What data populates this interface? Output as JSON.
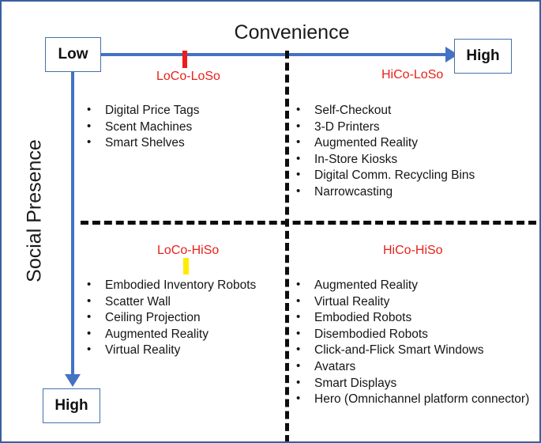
{
  "axes": {
    "x_title": "Convenience",
    "y_title": "Social Presence",
    "x_low_label": "Low",
    "x_high_label": "High",
    "y_low_label": "Low",
    "y_high_label": "High"
  },
  "colors": {
    "axis_blue": "#4472C4",
    "frame_blue": "#3a5f9e",
    "quad_label_red": "#e8211b",
    "marker_red": "#ee1c1c",
    "marker_yellow": "#ffeb00",
    "divider_black": "#0d0d0d"
  },
  "quadrants": [
    {
      "id": "loco-loso",
      "label": "LoCo-LoSo",
      "marker": "red",
      "items": [
        "Digital Price Tags",
        "Scent Machines",
        "Smart Shelves"
      ]
    },
    {
      "id": "hico-loso",
      "label": "HiCo-LoSo",
      "marker": "none",
      "items": [
        "Self-Checkout",
        "3-D Printers",
        "Augmented Reality",
        "In-Store Kiosks",
        "Digital Comm. Recycling Bins",
        "Narrowcasting"
      ]
    },
    {
      "id": "loco-hiso",
      "label": "LoCo-HiSo",
      "marker": "yellow",
      "items": [
        "Embodied Inventory Robots",
        "Scatter Wall",
        "Ceiling Projection",
        "Augmented Reality",
        "Virtual Reality"
      ]
    },
    {
      "id": "hico-hiso",
      "label": "HiCo-HiSo",
      "marker": "none",
      "items": [
        "Augmented Reality",
        "Virtual Reality",
        "Embodied Robots",
        "Disembodied Robots",
        "Click-and-Flick Smart Windows",
        "Avatars",
        "Smart Displays",
        "Hero (Omnichannel platform connector)"
      ]
    }
  ]
}
